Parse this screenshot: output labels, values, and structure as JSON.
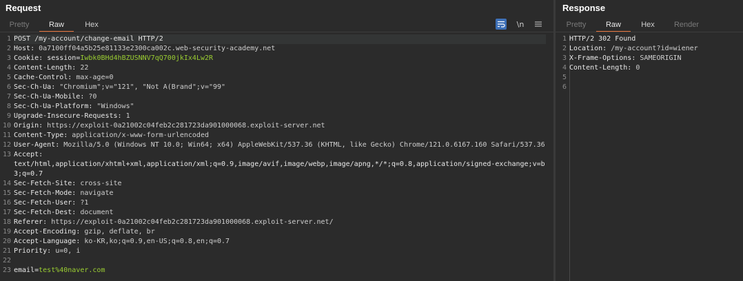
{
  "request": {
    "title": "Request",
    "tabs": [
      "Pretty",
      "Raw",
      "Hex"
    ],
    "active_tab": "Raw",
    "toolbar": {
      "wrap_icon": "wrap-lines-icon",
      "newline_label": "\\n",
      "menu_icon": "hamburger-menu-icon"
    },
    "lines": [
      {
        "n": "1",
        "text": "POST /my-account/change-email HTTP/2"
      },
      {
        "n": "2",
        "name": "Host",
        "value": " 0a7100ff04a5b25e81133e2300ca002c.web-security-academy.net"
      },
      {
        "n": "3",
        "name": "Cookie",
        "value": " ",
        "cookie_name": "session",
        "cookie_value": "Iwbk0BHd4hBZUSNNV7qQ700jkIx4Lw2R"
      },
      {
        "n": "4",
        "name": "Content-Length",
        "value": " 22"
      },
      {
        "n": "5",
        "name": "Cache-Control",
        "value": " max-age=0"
      },
      {
        "n": "6",
        "name": "Sec-Ch-Ua",
        "value": " \"Chromium\";v=\"121\", \"Not A(Brand\";v=\"99\""
      },
      {
        "n": "7",
        "name": "Sec-Ch-Ua-Mobile",
        "value": " ?0"
      },
      {
        "n": "8",
        "name": "Sec-Ch-Ua-Platform",
        "value": " \"Windows\""
      },
      {
        "n": "9",
        "name": "Upgrade-Insecure-Requests",
        "value": " 1"
      },
      {
        "n": "10",
        "name": "Origin",
        "value": " https://exploit-0a21002c04feb2c281723da901000068.exploit-server.net"
      },
      {
        "n": "11",
        "name": "Content-Type",
        "value": " application/x-www-form-urlencoded"
      },
      {
        "n": "12",
        "name": "User-Agent",
        "value": " Mozilla/5.0 (Windows NT 10.0; Win64; x64) AppleWebKit/537.36 (KHTML, like Gecko) Chrome/121.0.6167.160 Safari/537.36"
      },
      {
        "n": "13",
        "name": "Accept",
        "value": ""
      },
      {
        "n": "",
        "text": "text/html,application/xhtml+xml,application/xml;q=0.9,image/avif,image/webp,image/apng,*/*;q=0.8,application/signed-exchange;v=b"
      },
      {
        "n": "",
        "text": "3;q=0.7"
      },
      {
        "n": "14",
        "name": "Sec-Fetch-Site",
        "value": " cross-site"
      },
      {
        "n": "15",
        "name": "Sec-Fetch-Mode",
        "value": " navigate"
      },
      {
        "n": "16",
        "name": "Sec-Fetch-User",
        "value": " ?1"
      },
      {
        "n": "17",
        "name": "Sec-Fetch-Dest",
        "value": " document"
      },
      {
        "n": "18",
        "name": "Referer",
        "value": " https://exploit-0a21002c04feb2c281723da901000068.exploit-server.net/"
      },
      {
        "n": "19",
        "name": "Accept-Encoding",
        "value": " gzip, deflate, br"
      },
      {
        "n": "20",
        "name": "Accept-Language",
        "value": " ko-KR,ko;q=0.9,en-US;q=0.8,en;q=0.7"
      },
      {
        "n": "21",
        "name": "Priority",
        "value": " u=0, i"
      },
      {
        "n": "22",
        "text": ""
      },
      {
        "n": "23",
        "param_name": "email",
        "param_value": "test%40naver.com"
      }
    ]
  },
  "response": {
    "title": "Response",
    "tabs": [
      "Pretty",
      "Raw",
      "Hex",
      "Render"
    ],
    "active_tab": "Raw",
    "lines": [
      {
        "n": "1",
        "text": "HTTP/2 302 Found"
      },
      {
        "n": "2",
        "name": "Location",
        "value": " /my-account?id=wiener"
      },
      {
        "n": "3",
        "name": "X-Frame-Options",
        "value": " SAMEORIGIN"
      },
      {
        "n": "4",
        "name": "Content-Length",
        "value": " 0"
      },
      {
        "n": "5",
        "text": ""
      },
      {
        "n": "6",
        "text": ""
      }
    ]
  },
  "colors": {
    "accent": "#e8743b",
    "wrap_button": "#3d6fb6",
    "value_green": "#9acd32",
    "background": "#2b2b2b"
  }
}
